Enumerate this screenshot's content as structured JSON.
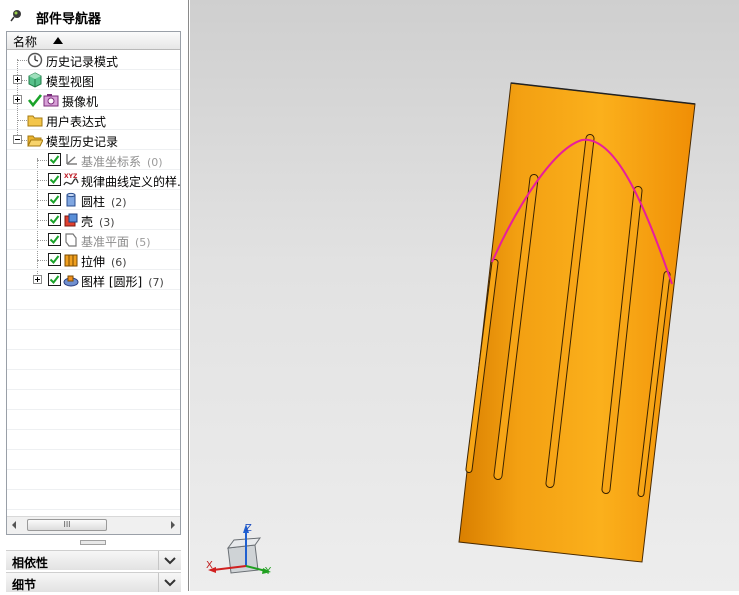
{
  "navigator": {
    "title": "部件导航器",
    "column_header": "名称",
    "items": [
      {
        "label": "历史记录模式",
        "count": "",
        "icon": "clock-icon",
        "state": "normal"
      },
      {
        "label": "模型视图",
        "count": "",
        "icon": "model-view-icon",
        "state": "normal"
      },
      {
        "label": "摄像机",
        "count": "",
        "icon": "camera-icon",
        "state": "normal"
      },
      {
        "label": "用户表达式",
        "count": "",
        "icon": "folder-icon",
        "state": "normal"
      },
      {
        "label": "模型历史记录",
        "count": "",
        "icon": "open-folder-icon",
        "state": "normal"
      },
      {
        "label": "基准坐标系",
        "count": "(0)",
        "icon": "datum-csys-icon",
        "state": "grey"
      },
      {
        "label": "规律曲线定义的样...",
        "count": "",
        "icon": "law-curve-icon",
        "state": "normal"
      },
      {
        "label": "圆柱",
        "count": "(2)",
        "icon": "cylinder-icon",
        "state": "normal"
      },
      {
        "label": "壳",
        "count": "(3)",
        "icon": "shell-icon",
        "state": "normal"
      },
      {
        "label": "基准平面",
        "count": "(5)",
        "icon": "datum-plane-icon",
        "state": "grey"
      },
      {
        "label": "拉伸",
        "count": "(6)",
        "icon": "extrude-icon",
        "state": "normal"
      },
      {
        "label": "图样 [圆形]",
        "count": "(7)",
        "icon": "pattern-icon",
        "state": "normal"
      }
    ],
    "scroll_thumb": "III",
    "panels": {
      "dependencies": "相依性",
      "details": "细节"
    }
  },
  "viewport": {
    "triad": {
      "x": "X",
      "y": "Y",
      "z": "Z"
    },
    "colors": {
      "body": "#f59c0a",
      "curve": "#e81e9c",
      "background": "#d9d9d9"
    }
  }
}
